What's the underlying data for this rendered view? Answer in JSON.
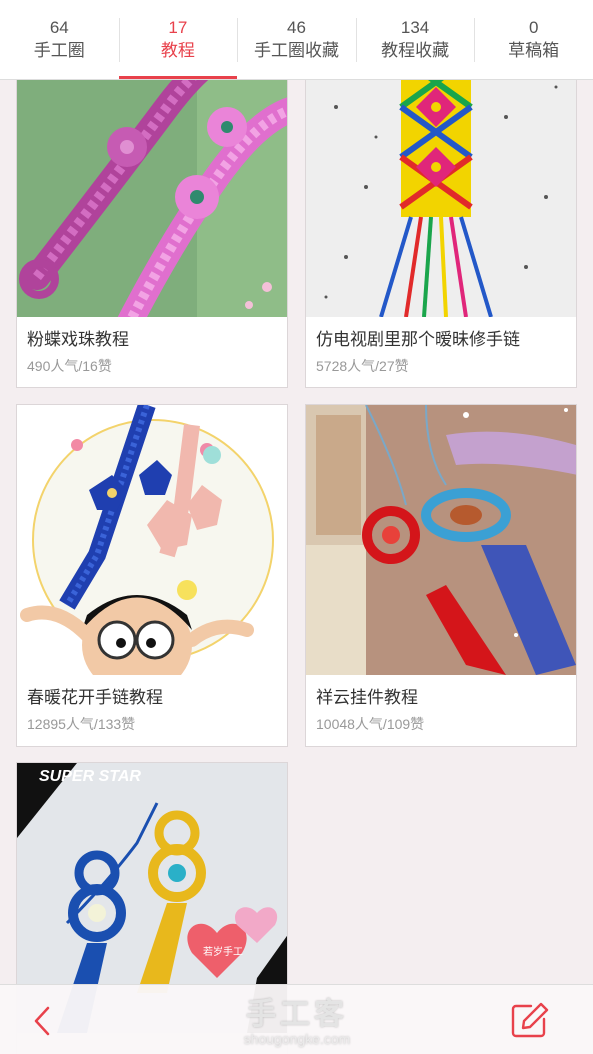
{
  "tabs": [
    {
      "count": "64",
      "label": "手工圈",
      "active": false
    },
    {
      "count": "17",
      "label": "教程",
      "active": true
    },
    {
      "count": "46",
      "label": "手工圈收藏",
      "active": false
    },
    {
      "count": "134",
      "label": "教程收藏",
      "active": false
    },
    {
      "count": "0",
      "label": "草稿箱",
      "active": false
    }
  ],
  "cards": [
    {
      "title": "粉蝶戏珠教程",
      "meta": "490人气/16赞",
      "image": "pink-macrame-bracelet-photo"
    },
    {
      "title": "仿电视剧里那个暧昧修手链",
      "meta": "5728人气/27赞",
      "image": "rainbow-knot-bracelet-photo"
    },
    {
      "title": "春暖花开手链教程",
      "meta": "12895人气/133赞",
      "image": "flower-bracelet-cartoon-photo"
    },
    {
      "title": "祥云挂件教程",
      "meta": "10048人气/109赞",
      "image": "tassel-pendant-photo"
    },
    {
      "title": "",
      "meta": "",
      "image": "blue-yellow-knot-pendant-photo",
      "overlay_text": "SUPER STAR",
      "stamp_text": "若岁手工"
    }
  ],
  "bottom_bar": {
    "back_icon": "chevron-left-icon",
    "edit_icon": "edit-icon"
  },
  "watermark": {
    "cn": "手工客",
    "en": "shougongke.com"
  },
  "colors": {
    "accent": "#e8414b",
    "background": "#f4eef0"
  }
}
